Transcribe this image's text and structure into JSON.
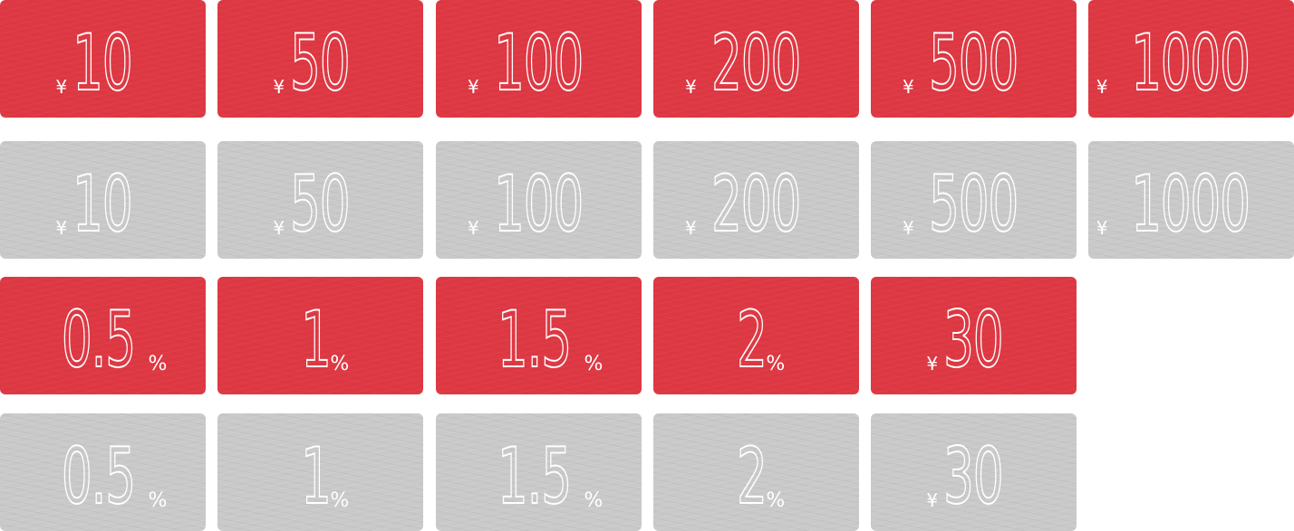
{
  "rows": [
    {
      "variant": "red",
      "cards": [
        {
          "prefix": "¥",
          "value": "10",
          "suffix": ""
        },
        {
          "prefix": "¥",
          "value": "50",
          "suffix": ""
        },
        {
          "prefix": "¥",
          "value": "100",
          "suffix": ""
        },
        {
          "prefix": "¥",
          "value": "200",
          "suffix": ""
        },
        {
          "prefix": "¥",
          "value": "500",
          "suffix": ""
        },
        {
          "prefix": "¥",
          "value": "1000",
          "suffix": ""
        }
      ]
    },
    {
      "variant": "gray",
      "cards": [
        {
          "prefix": "¥",
          "value": "10",
          "suffix": ""
        },
        {
          "prefix": "¥",
          "value": "50",
          "suffix": ""
        },
        {
          "prefix": "¥",
          "value": "100",
          "suffix": ""
        },
        {
          "prefix": "¥",
          "value": "200",
          "suffix": ""
        },
        {
          "prefix": "¥",
          "value": "500",
          "suffix": ""
        },
        {
          "prefix": "¥",
          "value": "1000",
          "suffix": ""
        }
      ]
    },
    {
      "variant": "red",
      "cards": [
        {
          "prefix": "",
          "value": "0.5",
          "suffix": "%"
        },
        {
          "prefix": "",
          "value": "1",
          "suffix": "%"
        },
        {
          "prefix": "",
          "value": "1.5",
          "suffix": "%"
        },
        {
          "prefix": "",
          "value": "2",
          "suffix": "%"
        },
        {
          "prefix": "¥",
          "value": "30",
          "suffix": ""
        }
      ]
    },
    {
      "variant": "gray",
      "cards": [
        {
          "prefix": "",
          "value": "0.5",
          "suffix": "%"
        },
        {
          "prefix": "",
          "value": "1",
          "suffix": "%"
        },
        {
          "prefix": "",
          "value": "1.5",
          "suffix": "%"
        },
        {
          "prefix": "",
          "value": "2",
          "suffix": "%"
        },
        {
          "prefix": "¥",
          "value": "30",
          "suffix": ""
        }
      ]
    }
  ],
  "colors": {
    "active": "#de3843",
    "inactive": "#c9c9c9",
    "text": "#ffffff"
  }
}
